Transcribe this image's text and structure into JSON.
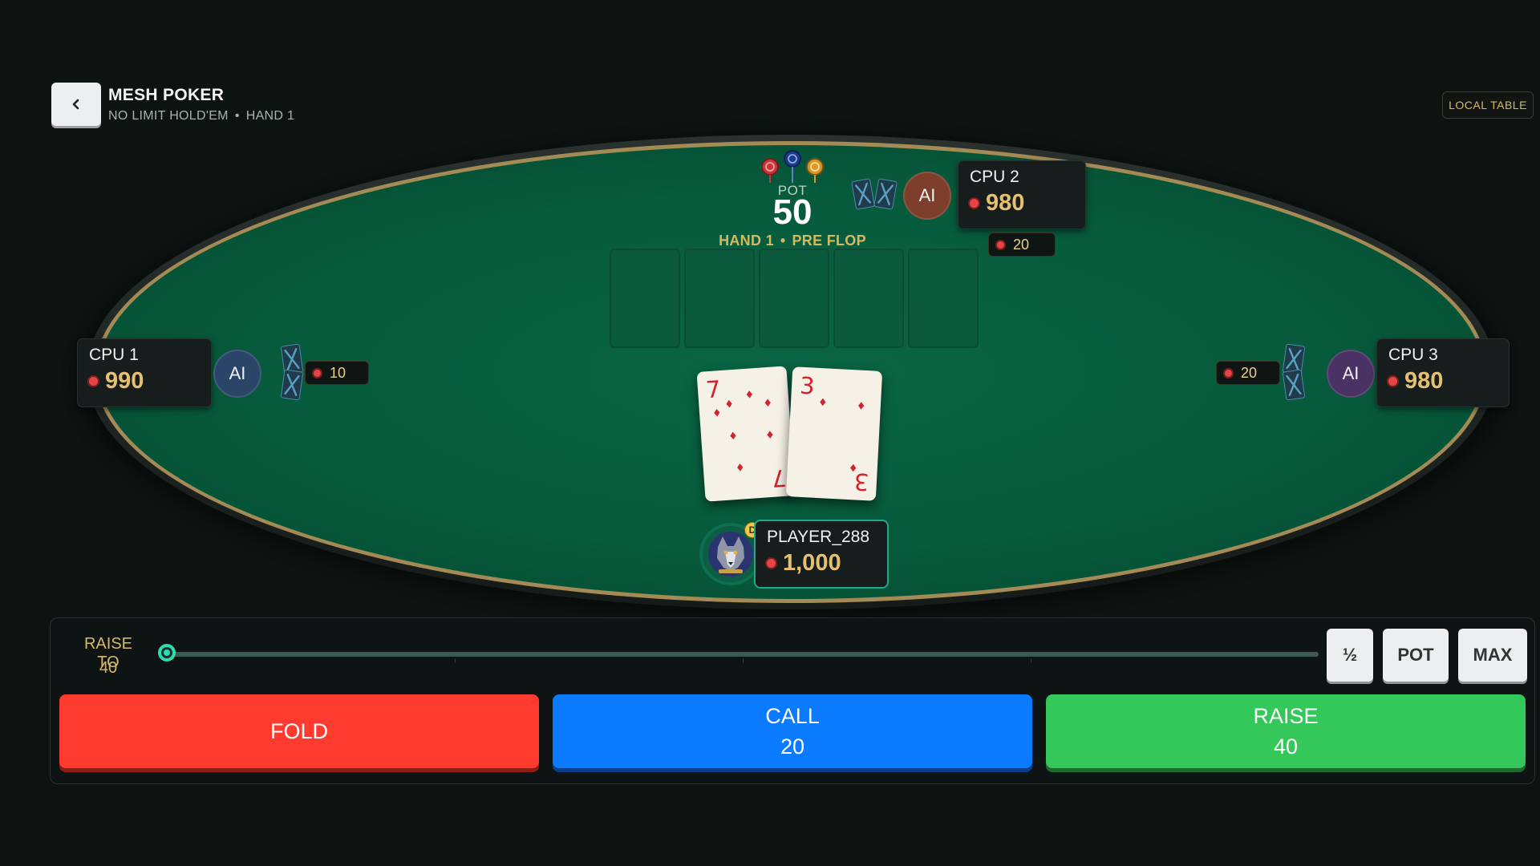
{
  "header": {
    "title": "MESH POKER",
    "subtitle_game": "NO LIMIT HOLD'EM",
    "subtitle_sep": "•",
    "subtitle_hand": "HAND 1",
    "badge": "LOCAL TABLE"
  },
  "pot": {
    "label": "POT",
    "value": "50",
    "hand": "HAND 1",
    "sep": "•",
    "street": "PRE FLOP"
  },
  "board": {
    "slots": 5
  },
  "players": {
    "cpu1": {
      "name": "CPU 1",
      "stack": "990",
      "avatar": "AI",
      "bet": "10",
      "avatar_color": "#2a4568"
    },
    "cpu2": {
      "name": "CPU 2",
      "stack": "980",
      "avatar": "AI",
      "bet": "20",
      "avatar_color": "#7d3f2b"
    },
    "cpu3": {
      "name": "CPU 3",
      "stack": "980",
      "avatar": "AI",
      "bet": "20",
      "avatar_color": "#4a3265"
    },
    "hero": {
      "name": "PLAYER_288",
      "stack": "1,000",
      "dealer": "D",
      "avatar_icon": "wolf-avatar"
    }
  },
  "hole_cards": [
    {
      "rank": "7",
      "suit": "♦",
      "color": "#d2242f"
    },
    {
      "rank": "3",
      "suit": "♦",
      "color": "#d2242f"
    }
  ],
  "controls": {
    "raise_label": "RAISE TO",
    "raise_value": "40",
    "slider_fraction": 0.0,
    "presets": {
      "half": "½",
      "pot": "POT",
      "max": "MAX"
    },
    "fold": {
      "label": "FOLD"
    },
    "call": {
      "label": "CALL",
      "amount": "20"
    },
    "raise": {
      "label": "RAISE",
      "amount": "40"
    }
  },
  "colors": {
    "felt": "#075a3c",
    "gold": "#a48b55",
    "accent_teal": "#2fdcb1",
    "fold": "#ff3b30",
    "call": "#0a7bff",
    "raise": "#34c759"
  }
}
